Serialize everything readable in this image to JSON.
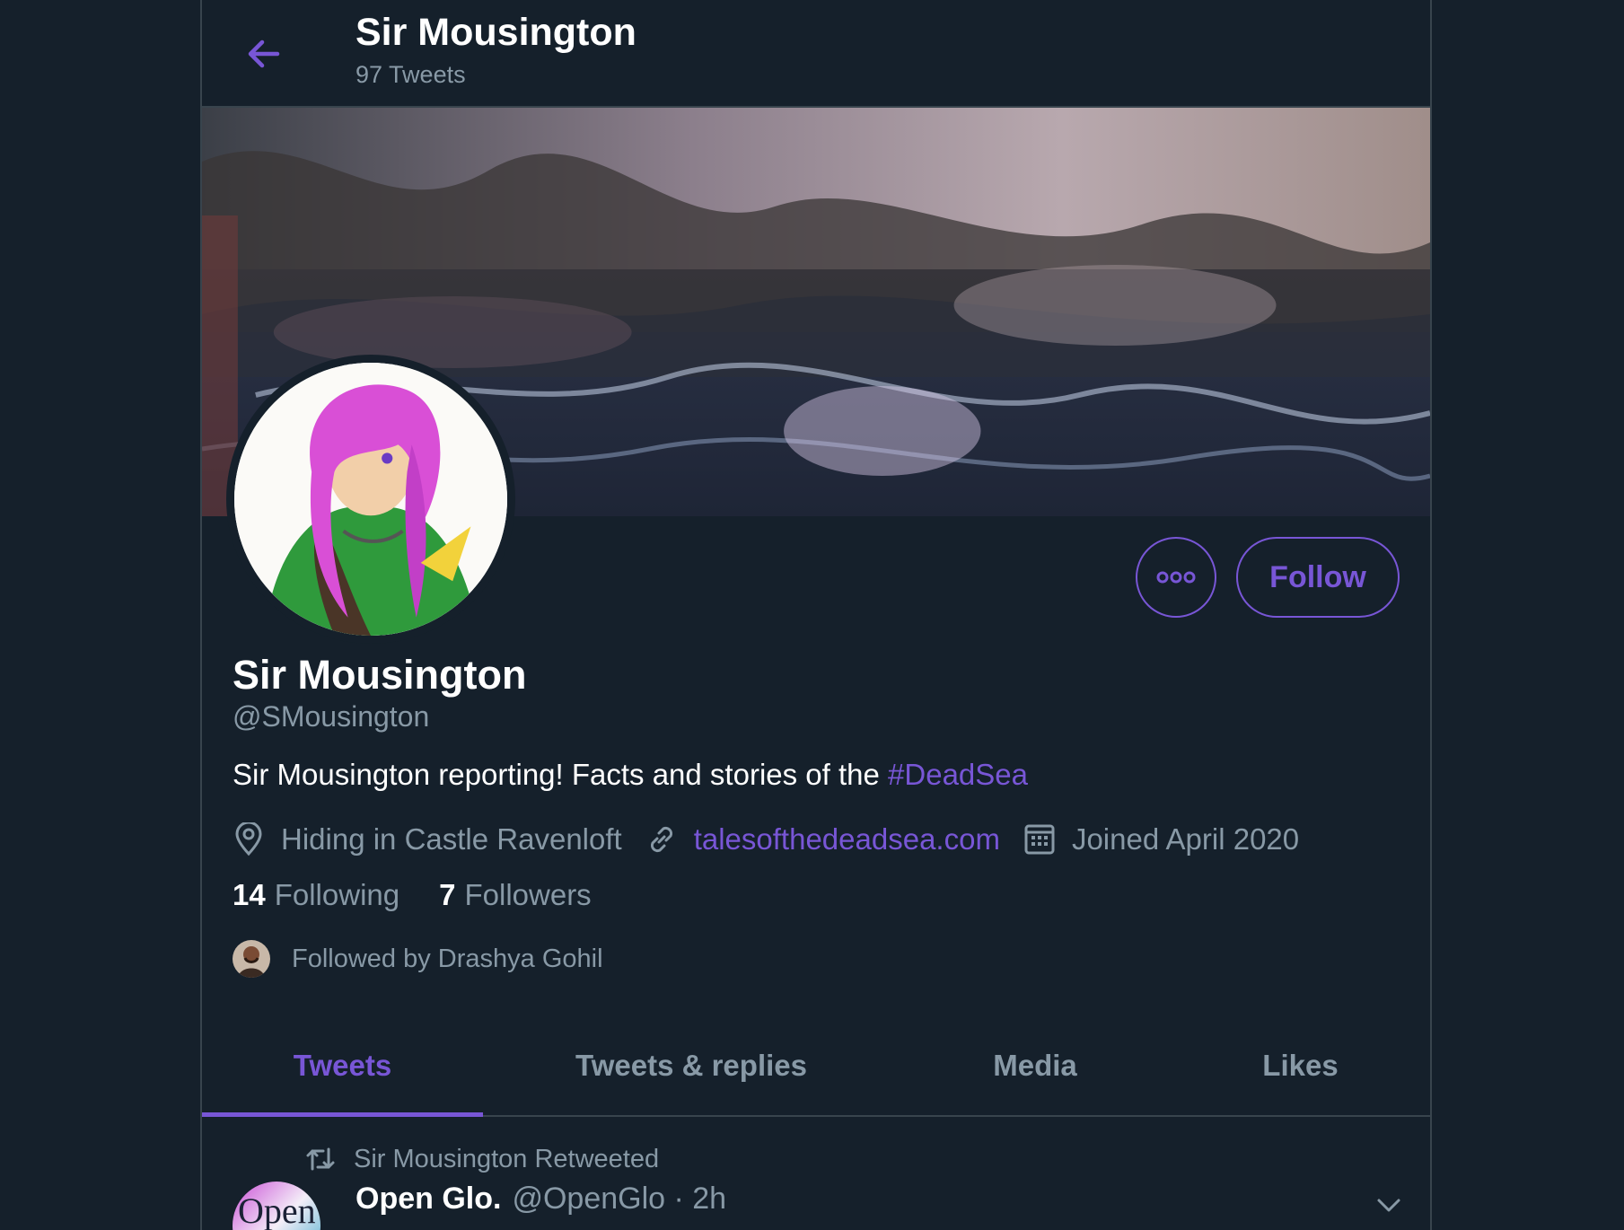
{
  "header": {
    "title": "Sir Mousington",
    "tweet_count": "97 Tweets"
  },
  "profile": {
    "name": "Sir Mousington",
    "handle": "@SMousington",
    "bio_text": "Sir Mousington reporting! Facts and stories of the ",
    "bio_hashtag": "#DeadSea",
    "location": "Hiding in Castle Ravenloft",
    "website": "talesofthedeadsea.com",
    "joined": "Joined April 2020",
    "following_count": "14",
    "following_label": "Following",
    "followers_count": "7",
    "followers_label": "Followers",
    "followed_by": "Followed by Drashya Gohil"
  },
  "actions": {
    "follow_label": "Follow"
  },
  "tabs": [
    {
      "label": "Tweets",
      "active": true
    },
    {
      "label": "Tweets & replies",
      "active": false
    },
    {
      "label": "Media",
      "active": false
    },
    {
      "label": "Likes",
      "active": false
    }
  ],
  "tweet": {
    "retweet_label": "Sir Mousington Retweeted",
    "author_name": "Open Glo.",
    "author_meta": "@OpenGlo · 2h",
    "avatar_text": "Open"
  },
  "colors": {
    "accent": "#7856d6",
    "background": "#15202b",
    "muted": "#8899a6",
    "border": "#38444d"
  }
}
